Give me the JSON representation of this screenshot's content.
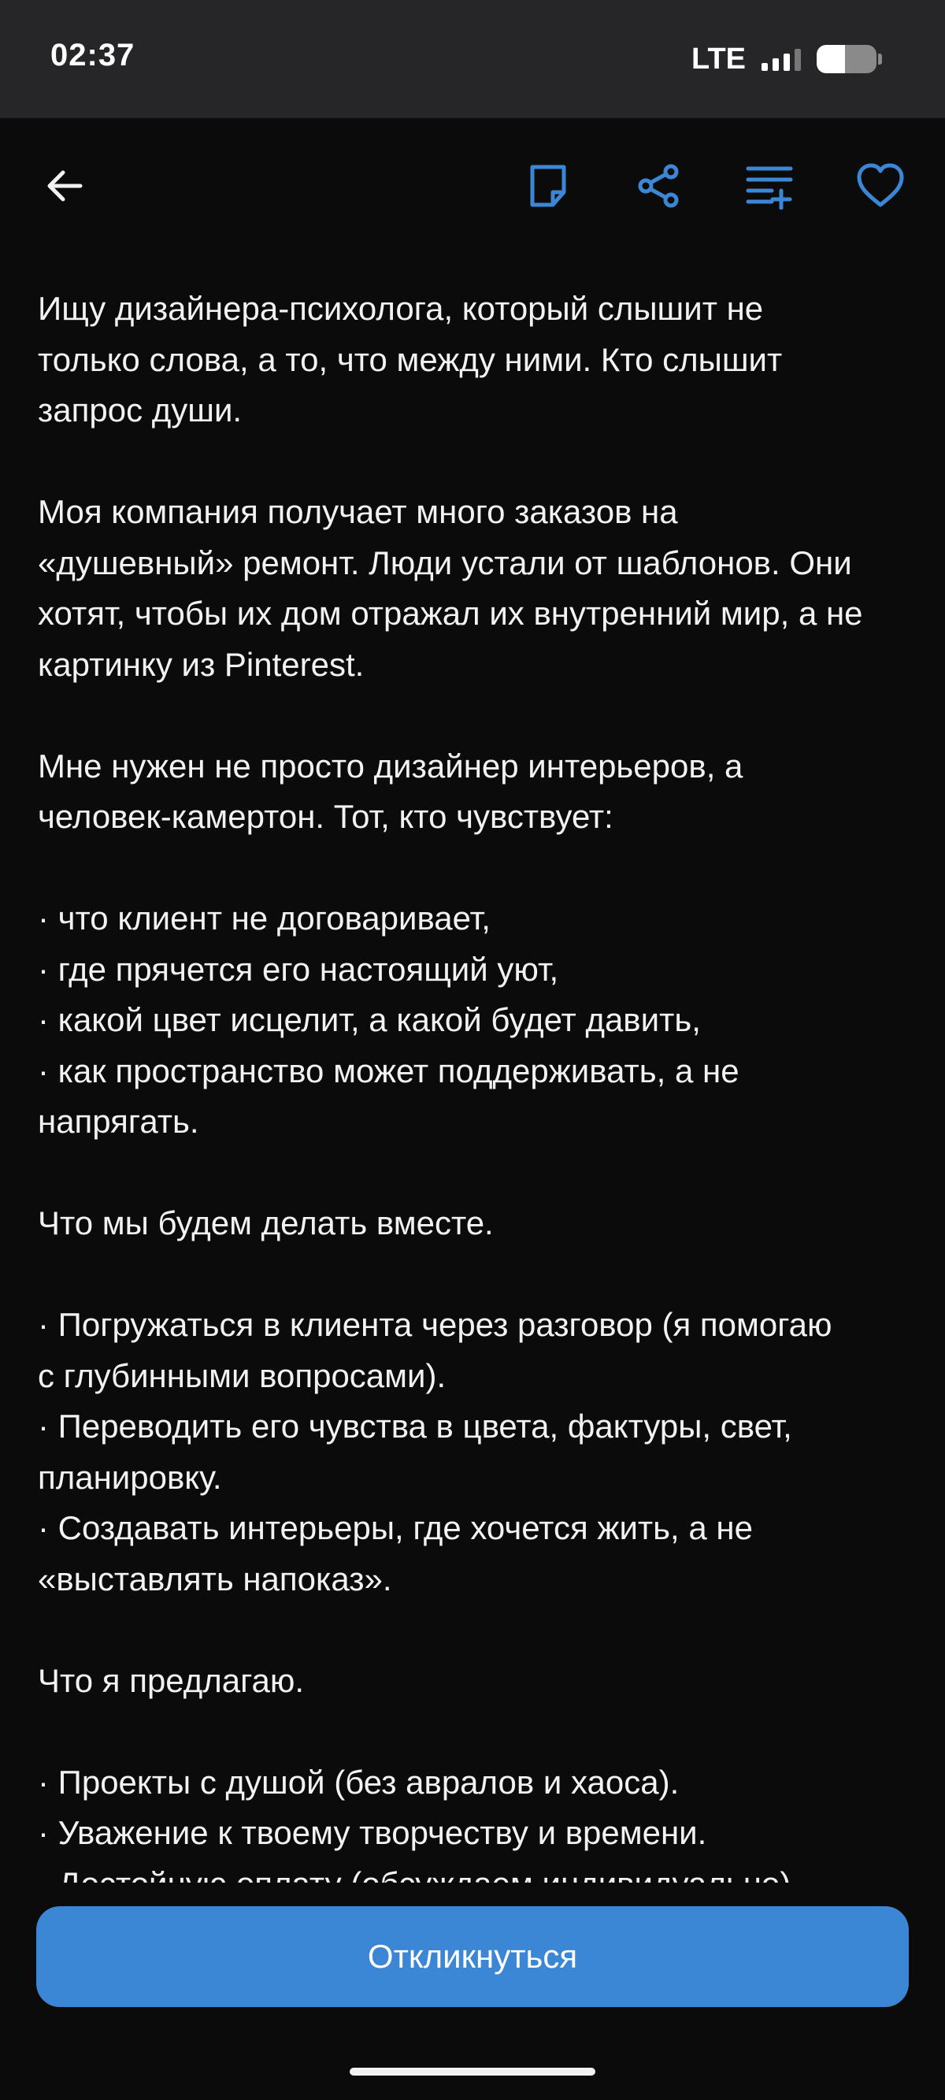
{
  "status_bar": {
    "time": "02:37",
    "network": "LTE"
  },
  "toolbar": {
    "icons": [
      "back-arrow-icon",
      "note-icon",
      "share-icon",
      "add-to-list-icon",
      "heart-icon"
    ],
    "accent_color": "#3c87d5"
  },
  "content": {
    "paragraphs": [
      [
        "Ищу дизайнера-психолога, который слышит не",
        "только слова, а то, что между ними. Кто слышит",
        "запрос души."
      ],
      [
        "Моя компания получает много заказов на",
        "«душевный» ремонт. Люди устали от шаблонов. Они",
        "хотят, чтобы их дом отражал их внутренний мир, а не",
        "картинку из Pinterest."
      ],
      [
        "Мне нужен не просто дизайнер интерьеров, а",
        "человек-камертон. Тот, кто чувствует:"
      ],
      [
        "· что клиент не договаривает,",
        "· где прячется его настоящий уют,",
        "· какой цвет исцелит, а какой будет давить,",
        "· как пространство может поддерживать, а не",
        "напрягать."
      ],
      [
        "Что мы будем делать вместе."
      ],
      [
        "· Погружаться в клиента через разговор (я помогаю",
        "с глубинными вопросами).",
        "· Переводить его чувства в цвета, фактуры, свет,",
        "планировку.",
        "· Создавать интерьеры, где хочется жить, а не",
        "«выставлять напоказ»."
      ],
      [
        "Что я предлагаю."
      ],
      [
        "· Проекты с душой (без авралов и хаоса).",
        "· Уважение к твоему творчеству и времени.",
        "· Достойную оплату (обсуждаем индивидуально)."
      ]
    ]
  },
  "respond_button": {
    "label": "Откликнуться"
  }
}
